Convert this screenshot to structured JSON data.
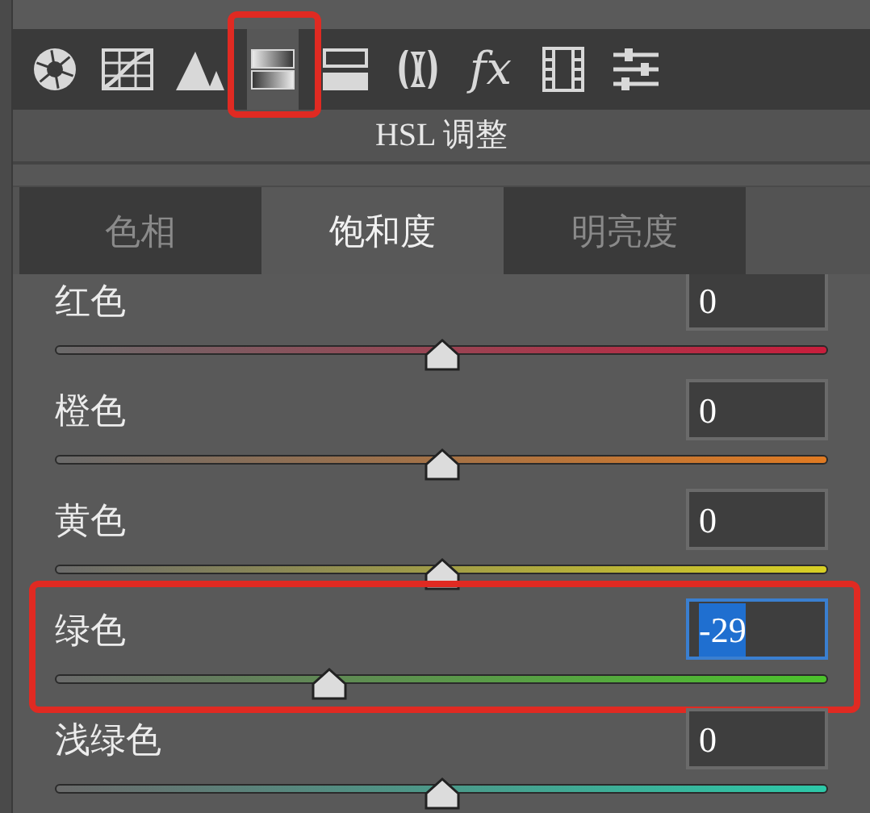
{
  "toolbar": {
    "items": [
      {
        "kind": "aperture",
        "selected": false,
        "annotated": false
      },
      {
        "kind": "curve",
        "selected": false,
        "annotated": false
      },
      {
        "kind": "mountains",
        "selected": false,
        "annotated": false
      },
      {
        "kind": "gradient-bars",
        "selected": true,
        "annotated": true
      },
      {
        "kind": "split-bars",
        "selected": false,
        "annotated": false
      },
      {
        "kind": "lens",
        "selected": false,
        "annotated": false
      },
      {
        "kind": "fx",
        "label": "fx",
        "selected": false,
        "annotated": false
      },
      {
        "kind": "film",
        "selected": false,
        "annotated": false
      },
      {
        "kind": "sliders",
        "selected": false,
        "annotated": false
      }
    ]
  },
  "panel": {
    "title": "HSL 调整"
  },
  "tabs": [
    {
      "label": "色相",
      "selected": false
    },
    {
      "label": "饱和度",
      "selected": true
    },
    {
      "label": "明亮度",
      "selected": false
    }
  ],
  "channels": [
    {
      "name": "红色",
      "value": "0",
      "level": 0.5,
      "color": "#c81e3c",
      "focused": false,
      "annotated": false
    },
    {
      "name": "橙色",
      "value": "0",
      "level": 0.5,
      "color": "#e07a22",
      "focused": false,
      "annotated": false
    },
    {
      "name": "黄色",
      "value": "0",
      "level": 0.5,
      "color": "#d8d024",
      "focused": false,
      "annotated": false
    },
    {
      "name": "绿色",
      "value": "-29",
      "level": 0.355,
      "color": "#4cc22c",
      "focused": true,
      "annotated": true
    },
    {
      "name": "浅绿色",
      "value": "0",
      "level": 0.5,
      "color": "#2cc8a8",
      "focused": false,
      "annotated": false
    }
  ]
}
